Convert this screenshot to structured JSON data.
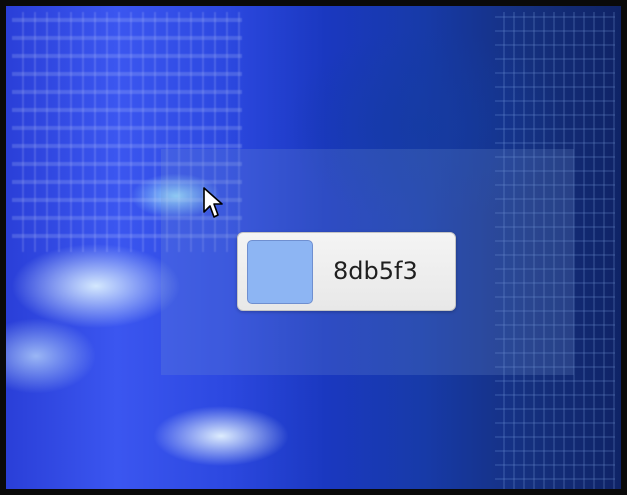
{
  "color_picker_popup": {
    "swatch_color": "#8db5f3",
    "hex_value": "8db5f3"
  },
  "icons": {
    "pointer": "mouse-pointer-icon"
  }
}
